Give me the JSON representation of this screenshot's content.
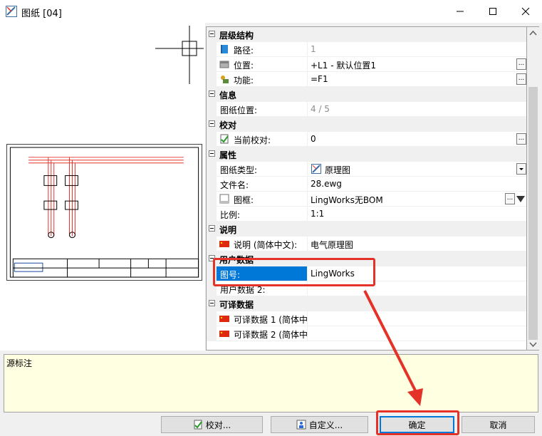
{
  "window": {
    "title": "图纸 [04]"
  },
  "sections": {
    "hierarchy": "层级结构",
    "info": "信息",
    "proof": "校对",
    "props": "属性",
    "desc": "说明",
    "userdata": "用户数据",
    "transdata": "可译数据"
  },
  "rows": {
    "path": {
      "label": "路径:",
      "value": "1"
    },
    "location": {
      "label": "位置:",
      "value": "+L1 - 默认位置1"
    },
    "function": {
      "label": "功能:",
      "value": "=F1"
    },
    "sheetpos": {
      "label": "图纸位置:",
      "value": "4 / 5"
    },
    "current_proof": {
      "label": "当前校对:",
      "value": "0"
    },
    "sheet_type": {
      "label": "图纸类型:",
      "value": "原理图"
    },
    "filename": {
      "label": "文件名:",
      "value": "28.ewg"
    },
    "frame": {
      "label": "图框:",
      "value": "LingWorks无BOM"
    },
    "scale": {
      "label": "比例:",
      "value": "1:1"
    },
    "description": {
      "label": "说明 (简体中文):",
      "value": "电气原理图"
    },
    "drawing_no": {
      "label": "图号:",
      "value": "LingWorks"
    },
    "userdata2": {
      "label": "用户数据 2:",
      "value": ""
    },
    "trans1": {
      "label": "可译数据 1 (简体中",
      "value": ""
    },
    "trans2": {
      "label": "可译数据 2 (简体中",
      "value": ""
    }
  },
  "note": {
    "label": "源标注"
  },
  "buttons": {
    "proof": "校对...",
    "custom": "自定义...",
    "ok": "确定",
    "cancel": "取消"
  },
  "colors": {
    "accent": "#0078d7",
    "annotation": "#e53229",
    "note_bg": "#ffffe1"
  }
}
